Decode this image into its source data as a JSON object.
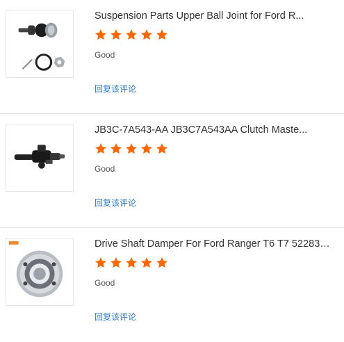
{
  "colors": {
    "star": "#ff6600",
    "link": "#2f7bc6",
    "divider": "#e5e5e5"
  },
  "reviews": [
    {
      "title": "Suspension Parts Upper Ball Joint for Ford R...",
      "rating": 5,
      "comment": "Good",
      "reply_label": "回复该评论",
      "image_icon": "ball-joint-icon"
    },
    {
      "title": "JB3C-7A543-AA JB3C7A543AA Clutch Maste...",
      "rating": 5,
      "comment": "Good",
      "reply_label": "回复该评论",
      "image_icon": "clutch-master-cylinder-icon"
    },
    {
      "title": "Drive Shaft Damper For Ford Ranger T6 T7 522834...",
      "rating": 5,
      "comment": "Good",
      "reply_label": "回复该评论",
      "image_icon": "drive-shaft-damper-icon"
    }
  ]
}
